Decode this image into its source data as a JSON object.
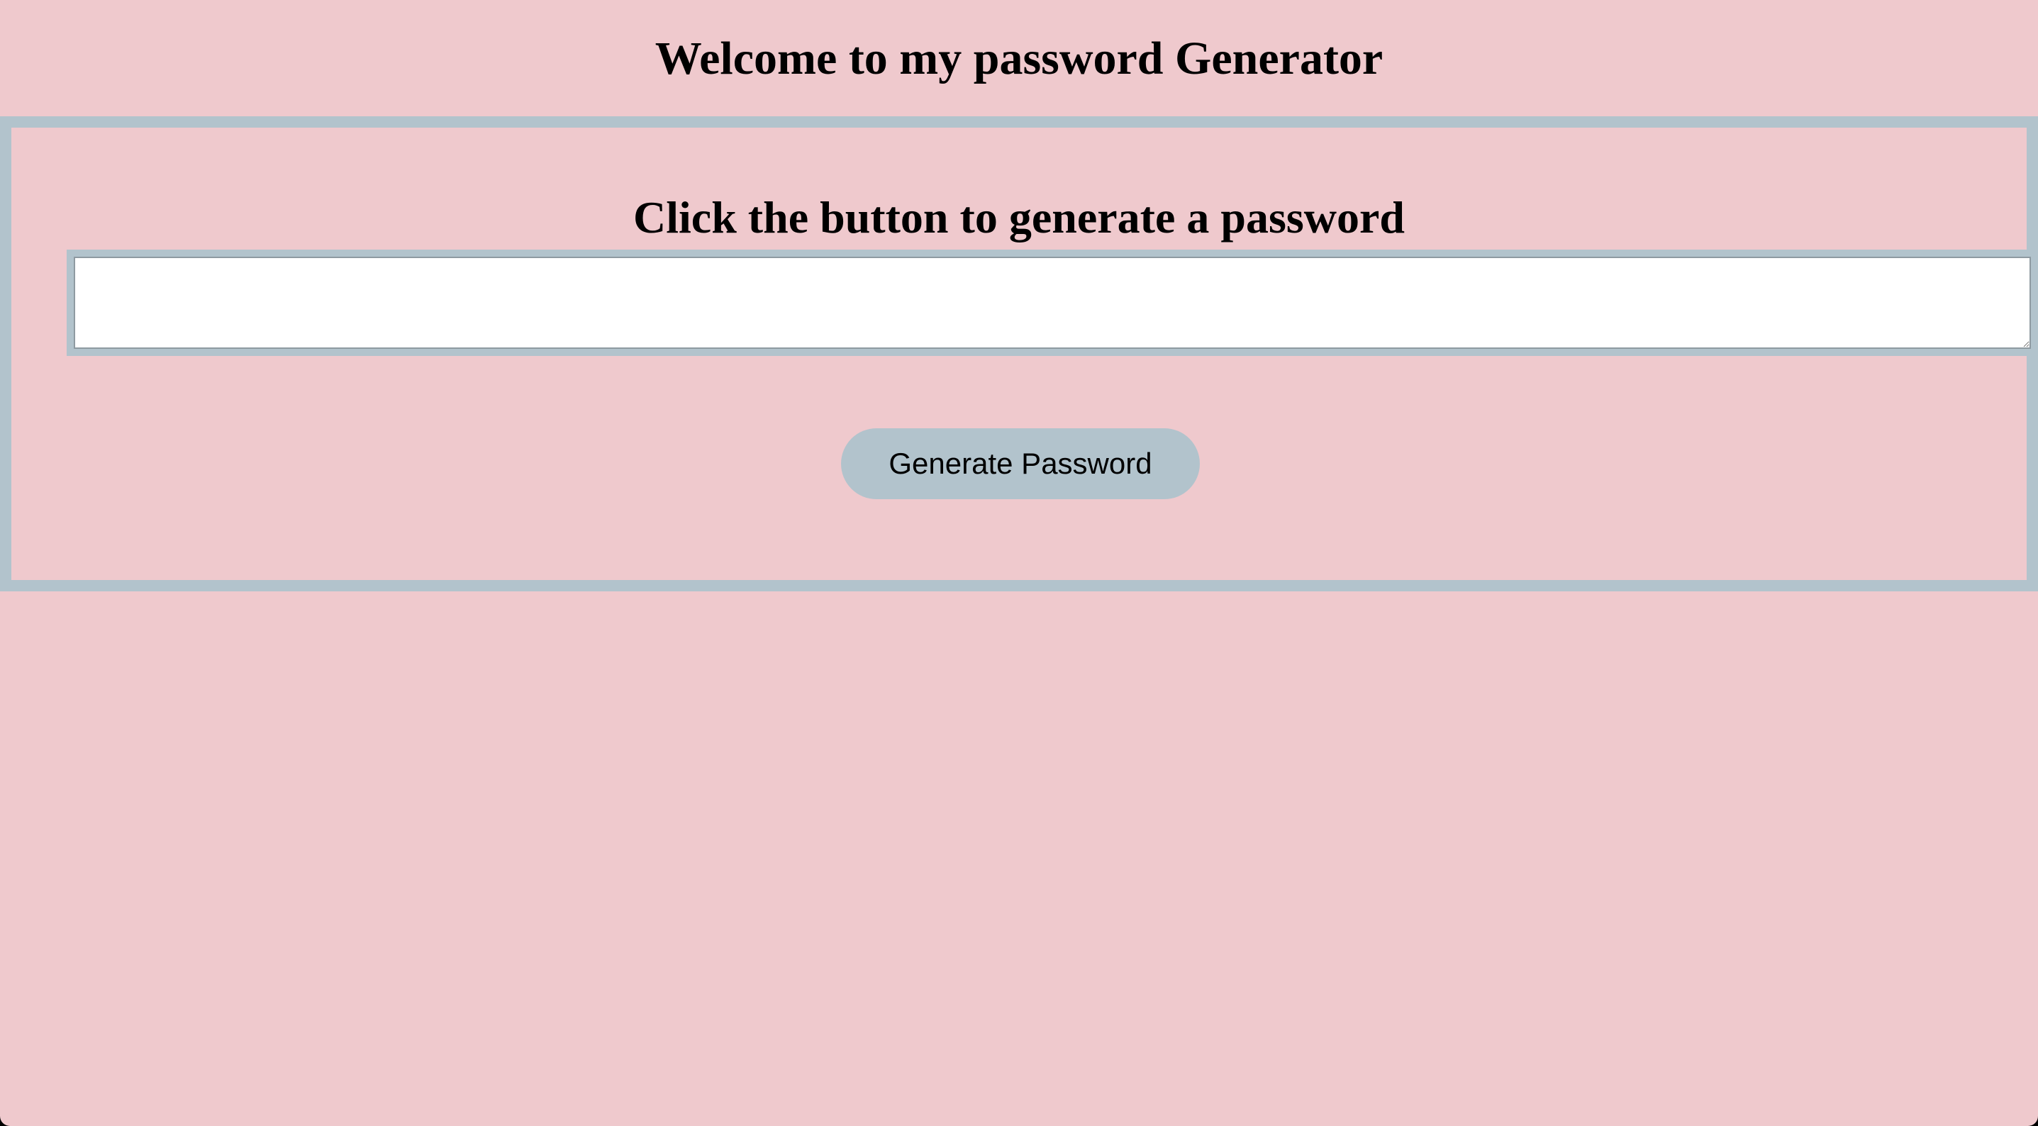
{
  "header": {
    "title": "Welcome to my password Generator"
  },
  "card": {
    "heading": "Click the button to generate a password",
    "password_value": "",
    "password_placeholder": "",
    "button_label": "Generate Password"
  },
  "colors": {
    "background": "#efc9cd",
    "accent": "#b2c3cc",
    "text": "#000000",
    "input_background": "#ffffff"
  }
}
